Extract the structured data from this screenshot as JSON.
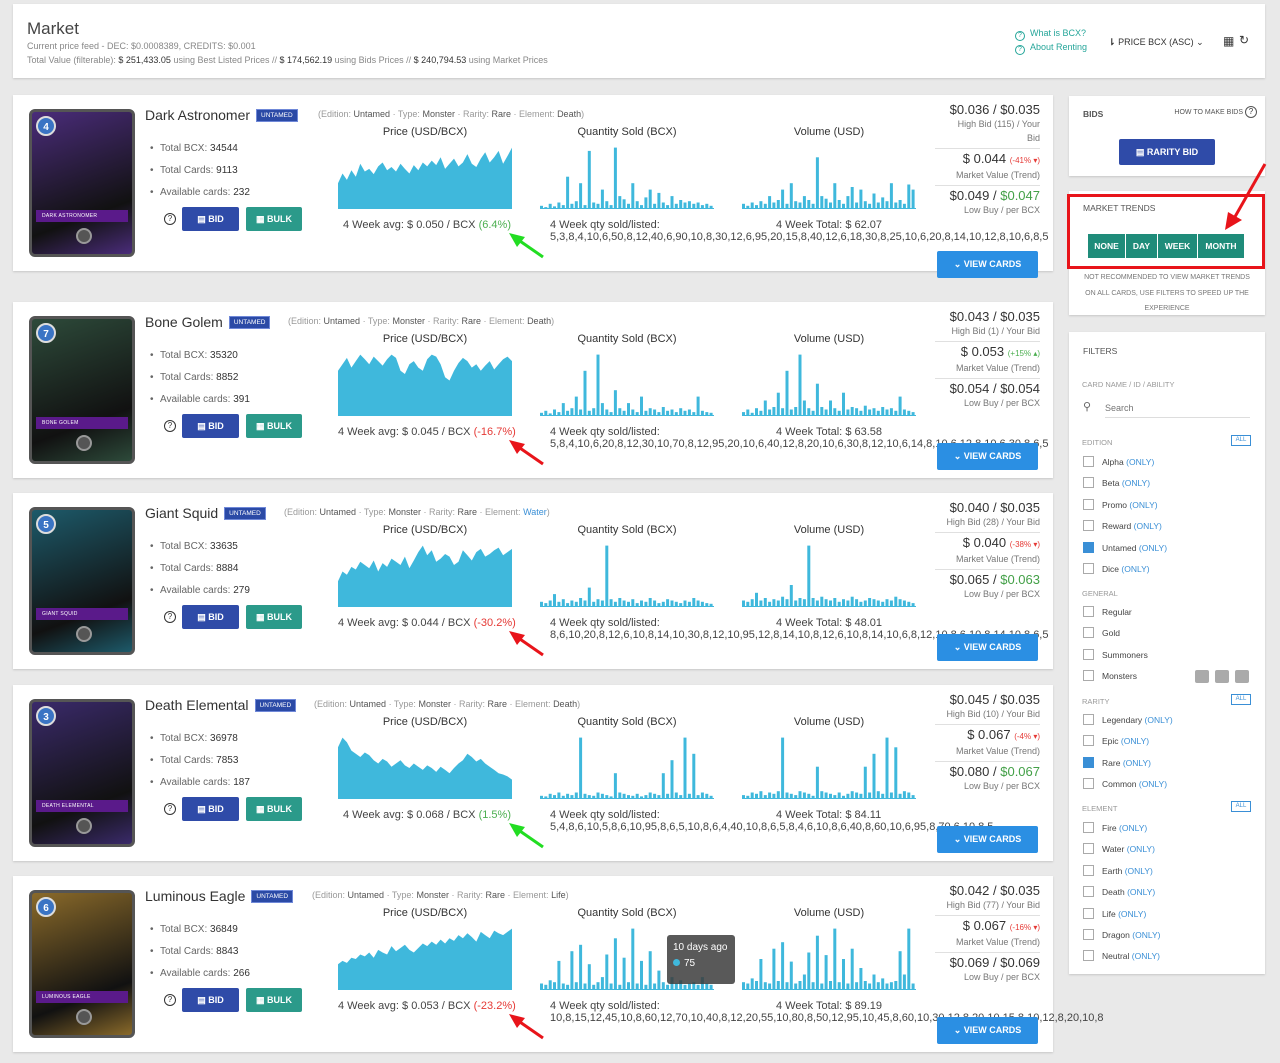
{
  "header": {
    "title": "Market",
    "feed_label": "Current price feed - DEC: $0.0008389, CREDITS: $0.001",
    "total_prefix": "Total Value (filterable):",
    "total_best": "$ 251,433.05",
    "total_best_suffix": "using Best Listed Prices //",
    "total_bids": "$ 174,562.19",
    "total_bids_suffix": "using Bids Prices //",
    "total_market": "$ 240,794.53",
    "total_market_suffix": "using Market Prices",
    "what_is_bcx": "What is BCX?",
    "about_renting": "About Renting",
    "sort_label": "PRICE BCX (ASC)",
    "sort_icon": "sort-icon",
    "grid_icon": "grid-icon",
    "refresh_icon": "refresh-icon"
  },
  "labels": {
    "untamed_tag": "UNTAMED",
    "edition_k": "(Edition:",
    "edition_v": "Untamed",
    "type_k": "Type:",
    "type_v": "Monster",
    "rarity_k": "Rarity:",
    "rarity_v": "Rare",
    "element_k": "Element:",
    "total_bcx": "Total BCX:",
    "total_cards": "Total Cards:",
    "available": "Available cards:",
    "bid": "BID",
    "bulk": "BULK",
    "price_title": "Price (USD/BCX)",
    "qty_title": "Quantity Sold (BCX)",
    "vol_title": "Volume (USD)",
    "avg_prefix": "4 Week avg:",
    "qty_prefix": "4 Week qty sold/listed:",
    "vol_prefix": "4 Week Total:",
    "market_value": "Market Value (Trend)",
    "low_buy": "Low Buy / per BCX",
    "view_cards": "VIEW CARDS",
    "qmark": "?"
  },
  "cards": [
    {
      "name": "Dark Astronomer",
      "level": "4",
      "element": "Death",
      "total_bcx": "34544",
      "total_cards": "9113",
      "available": "232",
      "avg": "$ 0.050 / BCX",
      "trend": "(6.4%)",
      "trend_dir": "pos",
      "qty": [
        5,
        3,
        8,
        4,
        10,
        6,
        50,
        8,
        12,
        40,
        6,
        90,
        10,
        8,
        30,
        12,
        6,
        95,
        20,
        15,
        8,
        40,
        12,
        6,
        18,
        30,
        8,
        25,
        10,
        6,
        20,
        8,
        14,
        10,
        12,
        8,
        10,
        6,
        8,
        5
      ],
      "vol": "$ 62.07",
      "bid_price": "$0.036 / $0.035",
      "bid_sub1": "High Bid (115) / Your",
      "bid_sub2": "Bid",
      "mv": "$ 0.044",
      "mv_trend": "(-41% ▾)",
      "mv_dir": "neg",
      "low": "$0.049 /",
      "low2": "$0.047",
      "low2_green": true,
      "banner": "DARK ASTRONOMER",
      "art": "#4a2c7a",
      "price": [
        40,
        55,
        45,
        60,
        50,
        70,
        58,
        62,
        54,
        66,
        72,
        60,
        65,
        58,
        70,
        62,
        55,
        68,
        60,
        72,
        66,
        75,
        68,
        80,
        62,
        70,
        78,
        66,
        72,
        85,
        70,
        65,
        78,
        88,
        72,
        80,
        90,
        70,
        82,
        95
      ],
      "volume": [
        8,
        5,
        10,
        6,
        12,
        8,
        20,
        10,
        14,
        30,
        8,
        40,
        12,
        10,
        20,
        14,
        8,
        80,
        20,
        16,
        10,
        40,
        14,
        8,
        20,
        34,
        10,
        30,
        12,
        8,
        24,
        10,
        18,
        12,
        40,
        10,
        14,
        8,
        38,
        30
      ]
    },
    {
      "name": "Bone Golem",
      "level": "7",
      "element": "Death",
      "total_bcx": "35320",
      "total_cards": "8852",
      "available": "391",
      "avg": "$ 0.045 / BCX",
      "trend": "(-16.7%)",
      "trend_dir": "neg",
      "qty": [
        5,
        8,
        4,
        10,
        6,
        20,
        8,
        12,
        30,
        10,
        70,
        8,
        12,
        95,
        20,
        10,
        6,
        40,
        12,
        8,
        20,
        10,
        6,
        30,
        8,
        12,
        10,
        6,
        14,
        8,
        10,
        6,
        12,
        8,
        10,
        6,
        30,
        8,
        6,
        5
      ],
      "vol": "$ 63.58",
      "bid_price": "$0.043 / $0.035",
      "bid_sub1": "High Bid (1) / Your Bid",
      "bid_sub2": "",
      "mv": "$ 0.053",
      "mv_trend": "(+15% ▴)",
      "mv_dir": "pos",
      "low": "$0.054 /",
      "low2": "$0.054",
      "low2_green": false,
      "banner": "BONE GOLEM",
      "art": "#2d4a3a",
      "price": [
        70,
        80,
        90,
        75,
        85,
        95,
        88,
        80,
        92,
        85,
        78,
        88,
        95,
        90,
        70,
        65,
        80,
        85,
        75,
        70,
        88,
        95,
        92,
        80,
        60,
        55,
        70,
        82,
        90,
        85,
        75,
        80,
        70,
        78,
        85,
        72,
        80,
        88,
        92,
        85
      ],
      "volume": [
        6,
        10,
        5,
        12,
        8,
        24,
        10,
        14,
        36,
        12,
        70,
        10,
        14,
        95,
        24,
        12,
        8,
        50,
        14,
        10,
        24,
        12,
        8,
        36,
        10,
        14,
        12,
        8,
        16,
        10,
        12,
        8,
        14,
        10,
        12,
        8,
        30,
        10,
        8,
        6
      ]
    },
    {
      "name": "Giant Squid",
      "level": "5",
      "element": "Water",
      "total_bcx": "33635",
      "total_cards": "8884",
      "available": "279",
      "avg": "$ 0.044 / BCX",
      "trend": "(-30.2%)",
      "trend_dir": "neg",
      "qty": [
        8,
        6,
        10,
        20,
        8,
        12,
        6,
        10,
        8,
        14,
        10,
        30,
        8,
        12,
        10,
        95,
        12,
        8,
        14,
        10,
        8,
        12,
        6,
        10,
        8,
        14,
        10,
        6,
        8,
        12,
        10,
        8,
        6,
        10,
        8,
        14,
        10,
        8,
        6,
        5
      ],
      "vol": "$ 48.01",
      "bid_price": "$0.040 / $0.035",
      "bid_sub1": "High Bid (28) / Your Bid",
      "bid_sub2": "",
      "mv": "$ 0.040",
      "mv_trend": "(-38% ▾)",
      "mv_dir": "neg",
      "low": "$0.065 /",
      "low2": "$0.063",
      "low2_green": true,
      "banner": "GIANT SQUID",
      "art": "#1d5a6a",
      "price": [
        40,
        55,
        50,
        62,
        58,
        70,
        65,
        60,
        72,
        55,
        68,
        62,
        75,
        70,
        65,
        78,
        60,
        72,
        85,
        95,
        80,
        88,
        70,
        75,
        82,
        78,
        65,
        70,
        88,
        80,
        72,
        85,
        90,
        78,
        82,
        88,
        92,
        80,
        85,
        90
      ],
      "volume": [
        10,
        8,
        12,
        22,
        10,
        14,
        8,
        12,
        10,
        16,
        12,
        34,
        10,
        14,
        12,
        95,
        14,
        10,
        16,
        12,
        10,
        14,
        8,
        12,
        10,
        16,
        12,
        8,
        10,
        14,
        12,
        10,
        8,
        12,
        10,
        16,
        12,
        10,
        8,
        6
      ]
    },
    {
      "name": "Death Elemental",
      "level": "3",
      "element": "Death",
      "total_bcx": "36978",
      "total_cards": "7853",
      "available": "187",
      "avg": "$ 0.068 / BCX",
      "trend": "(1.5%)",
      "trend_dir": "pos",
      "qty": [
        5,
        4,
        8,
        6,
        10,
        5,
        8,
        6,
        10,
        95,
        8,
        6,
        5,
        10,
        8,
        6,
        4,
        40,
        10,
        8,
        6,
        5,
        8,
        4,
        6,
        10,
        8,
        6,
        40,
        8,
        60,
        10,
        6,
        95,
        8,
        70,
        6,
        10,
        8,
        5
      ],
      "vol": "$ 84.11",
      "bid_price": "$0.045 / $0.035",
      "bid_sub1": "High Bid (10) / Your Bid",
      "bid_sub2": "",
      "mv": "$ 0.067",
      "mv_trend": "(-4% ▾)",
      "mv_dir": "neg",
      "low": "$0.080 /",
      "low2": "$0.067",
      "low2_green": true,
      "banner": "DEATH ELEMENTAL",
      "art": "#3a2a6a",
      "price": [
        80,
        95,
        88,
        75,
        70,
        65,
        72,
        68,
        60,
        55,
        62,
        58,
        50,
        55,
        60,
        52,
        48,
        55,
        50,
        45,
        52,
        48,
        42,
        50,
        45,
        40,
        48,
        55,
        60,
        70,
        65,
        58,
        62,
        55,
        50,
        45,
        40,
        38,
        35,
        30
      ],
      "volume": [
        6,
        5,
        10,
        8,
        12,
        6,
        10,
        8,
        12,
        95,
        10,
        8,
        6,
        12,
        10,
        8,
        5,
        50,
        12,
        10,
        8,
        6,
        10,
        5,
        8,
        12,
        10,
        8,
        50,
        10,
        70,
        12,
        8,
        95,
        10,
        80,
        8,
        12,
        10,
        6
      ]
    },
    {
      "name": "Luminous Eagle",
      "level": "6",
      "element": "Life",
      "total_bcx": "36849",
      "total_cards": "8843",
      "available": "266",
      "avg": "$ 0.053 / BCX",
      "trend": "(-23.2%)",
      "trend_dir": "neg",
      "qty": [
        10,
        8,
        15,
        12,
        45,
        10,
        8,
        60,
        12,
        70,
        10,
        40,
        8,
        12,
        20,
        55,
        10,
        80,
        8,
        50,
        12,
        95,
        10,
        45,
        8,
        60,
        10,
        30,
        12,
        8,
        20,
        10,
        15,
        8,
        10,
        12,
        8,
        20,
        10,
        8
      ],
      "vol": "$ 89.19",
      "bid_price": "$0.042 / $0.035",
      "bid_sub1": "High Bid (77) / Your Bid",
      "bid_sub2": "",
      "mv": "$ 0.067",
      "mv_trend": "(-16% ▾)",
      "mv_dir": "neg",
      "low": "$0.069 /",
      "low2": "$0.069",
      "low2_green": false,
      "banner": "LUMINOUS EAGLE",
      "art": "#8a6a2a",
      "price": [
        40,
        45,
        42,
        50,
        48,
        55,
        52,
        58,
        50,
        62,
        58,
        55,
        68,
        60,
        65,
        70,
        62,
        58,
        65,
        72,
        68,
        75,
        70,
        78,
        72,
        80,
        76,
        85,
        80,
        88,
        82,
        75,
        90,
        85,
        80,
        92,
        88,
        85,
        90,
        95
      ],
      "volume": [
        12,
        10,
        18,
        14,
        48,
        12,
        10,
        64,
        14,
        74,
        12,
        44,
        10,
        14,
        24,
        58,
        12,
        84,
        10,
        54,
        14,
        95,
        12,
        48,
        10,
        64,
        12,
        34,
        14,
        10,
        24,
        12,
        18,
        10,
        12,
        14,
        60,
        24,
        95,
        10
      ]
    }
  ],
  "tooltip": {
    "title": "10 days ago",
    "value": "75"
  },
  "bids": {
    "title": "BIDS",
    "how": "HOW TO MAKE BIDS",
    "btn": "RARITY BID"
  },
  "trends": {
    "title": "MARKET TRENDS",
    "none": "NONE",
    "day": "DAY",
    "week": "WEEK",
    "month": "MONTH",
    "note1": "NOT RECOMMENDED TO VIEW MARKET TRENDS",
    "note2": "ON ALL CARDS, USE FILTERS TO SPEED UP THE",
    "note3": "EXPERIENCE"
  },
  "filters": {
    "title": "FILTERS",
    "search_label": "CARD NAME / ID / ABILITY",
    "search_placeholder": "Search",
    "all": "ALL",
    "only": "(ONLY)",
    "edition_label": "EDITION",
    "general_label": "GENERAL",
    "rarity_label": "RARITY",
    "element_label": "ELEMENT",
    "edition": [
      {
        "n": "Alpha",
        "on": false
      },
      {
        "n": "Beta",
        "on": false
      },
      {
        "n": "Promo",
        "on": false
      },
      {
        "n": "Reward",
        "on": false
      },
      {
        "n": "Untamed",
        "on": true
      },
      {
        "n": "Dice",
        "on": false
      }
    ],
    "general": [
      {
        "n": "Regular"
      },
      {
        "n": "Gold"
      },
      {
        "n": "Summoners"
      },
      {
        "n": "Monsters"
      }
    ],
    "rarity": [
      {
        "n": "Legendary",
        "on": false
      },
      {
        "n": "Epic",
        "on": false
      },
      {
        "n": "Rare",
        "on": true
      },
      {
        "n": "Common",
        "on": false
      }
    ],
    "element": [
      {
        "n": "Fire"
      },
      {
        "n": "Water"
      },
      {
        "n": "Earth"
      },
      {
        "n": "Death"
      },
      {
        "n": "Life"
      },
      {
        "n": "Dragon"
      },
      {
        "n": "Neutral"
      }
    ]
  },
  "colors": {
    "teal": "#1f8c7a",
    "blue": "#2f4ba8",
    "chart": "#3fb8dc",
    "highlight": "#e8141a"
  }
}
